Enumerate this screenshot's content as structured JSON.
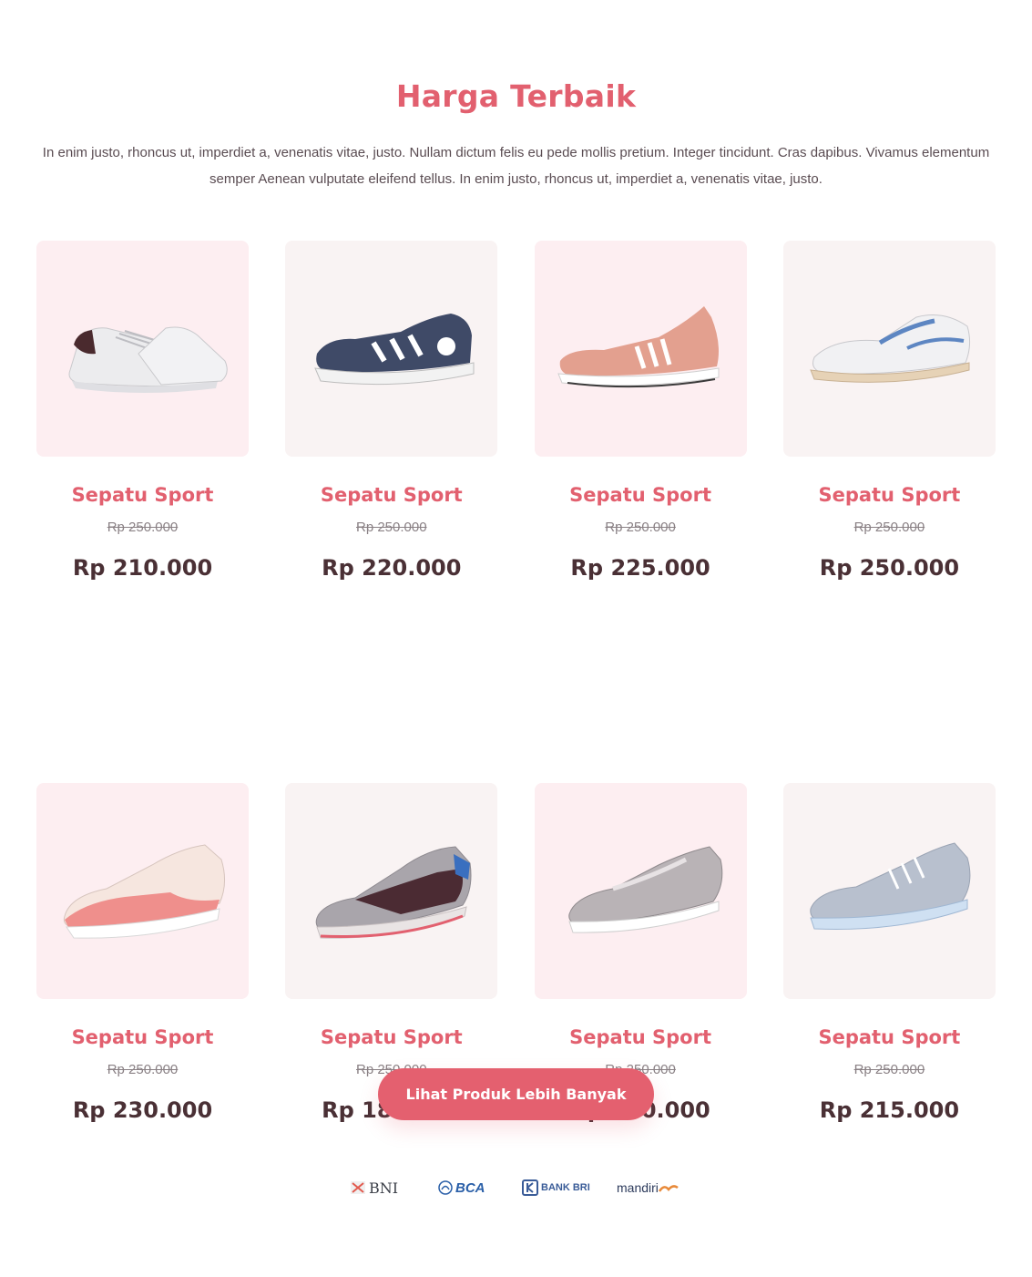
{
  "section": {
    "title": "Harga Terbaik",
    "intro": "In enim justo, rhoncus ut, imperdiet a, venenatis vitae, justo. Nullam dictum felis eu pede mollis pretium. Integer tincidunt. Cras dapibus. Vivamus elementum semper Aenean vulputate eleifend tellus. In enim justo, rhoncus ut, imperdiet a, venenatis vitae, justo."
  },
  "products": [
    {
      "name": "Sepatu Sport",
      "old_price": "Rp 250.000",
      "price": "Rp 210.000",
      "image": "white-sneaker-icon"
    },
    {
      "name": "Sepatu Sport",
      "old_price": "Rp 250.000",
      "price": "Rp 220.000",
      "image": "navy-running-shoe-icon"
    },
    {
      "name": "Sepatu Sport",
      "old_price": "Rp 250.000",
      "price": "Rp 225.000",
      "image": "peach-knit-shoe-icon"
    },
    {
      "name": "Sepatu Sport",
      "old_price": "Rp 250.000",
      "price": "Rp 250.000",
      "image": "white-blue-oxford-shoe-icon"
    },
    {
      "name": "Sepatu Sport",
      "old_price": "Rp 250.000",
      "price": "Rp 230.000",
      "image": "pink-retro-runner-icon"
    },
    {
      "name": "Sepatu Sport",
      "old_price": "Rp 250.000",
      "price": "Rp 189.000",
      "image": "maroon-grey-runner-icon"
    },
    {
      "name": "Sepatu Sport",
      "old_price": "Rp 250.000",
      "price": "Rp 200.000",
      "image": "silver-metallic-sneaker-icon"
    },
    {
      "name": "Sepatu Sport",
      "old_price": "Rp 250.000",
      "price": "Rp 215.000",
      "image": "grey-blue-knit-sneaker-icon"
    }
  ],
  "cta": {
    "label": "Lihat Produk Lebih Banyak"
  },
  "banks": [
    {
      "name": "BNI",
      "icon": "bni-logo-icon"
    },
    {
      "name": "BCA",
      "icon": "bca-logo-icon"
    },
    {
      "name": "BANK BRI",
      "icon": "bri-logo-icon"
    },
    {
      "name": "mandiri",
      "icon": "mandiri-logo-icon"
    }
  ],
  "colors": {
    "accent": "#e2606f",
    "price_text": "#4a3035",
    "card_pink": "#fdeef1",
    "card_cream": "#f9f3f3"
  }
}
